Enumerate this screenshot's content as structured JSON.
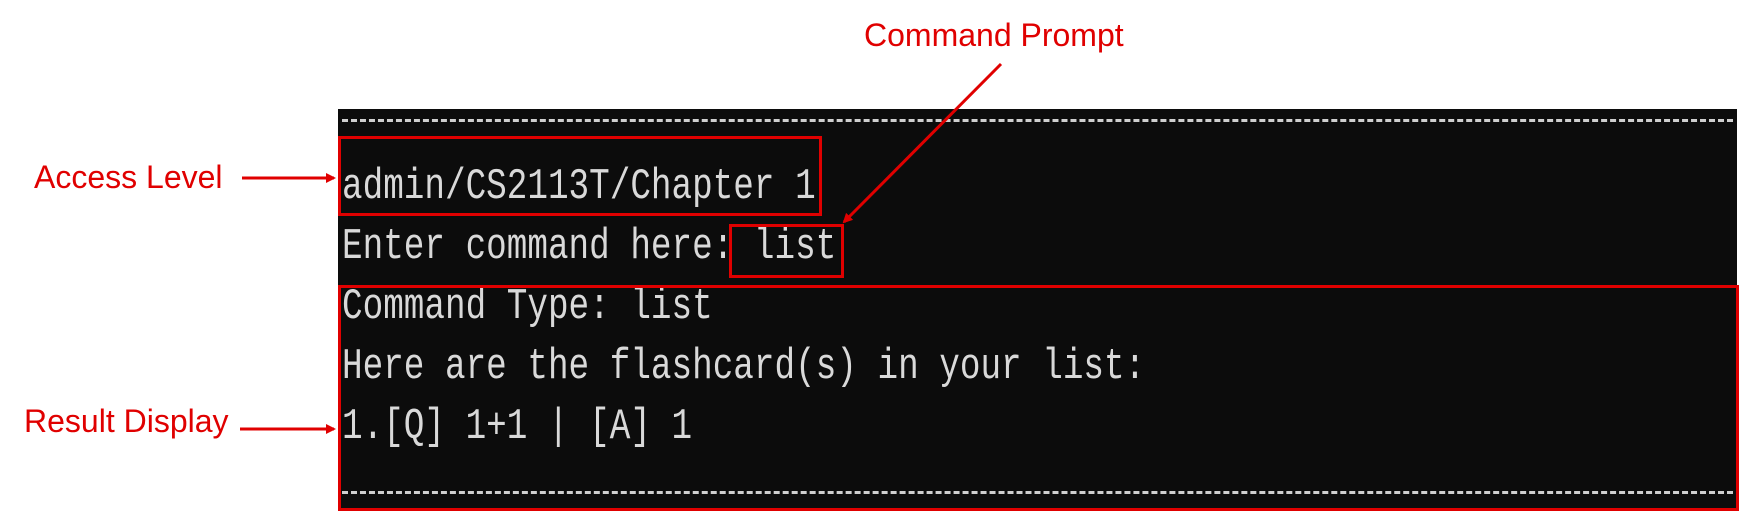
{
  "terminal": {
    "separator": "-----------------------------------------------------------------------------------",
    "access_level": "admin/CS2113T/Chapter 1",
    "prompt_label": "Enter command here: ",
    "command_input": "list",
    "result_lines": [
      "Command Type: list",
      "Here are the flashcard(s) in your list:",
      "1.[Q] 1+1 | [A] 1"
    ]
  },
  "annotations": {
    "command_prompt": "Command Prompt",
    "access_level": "Access Level",
    "result_display": "Result Display"
  },
  "colors": {
    "annotation": "#e00000",
    "terminal_background": "#0c0c0c",
    "terminal_text": "#d9d9d9"
  }
}
